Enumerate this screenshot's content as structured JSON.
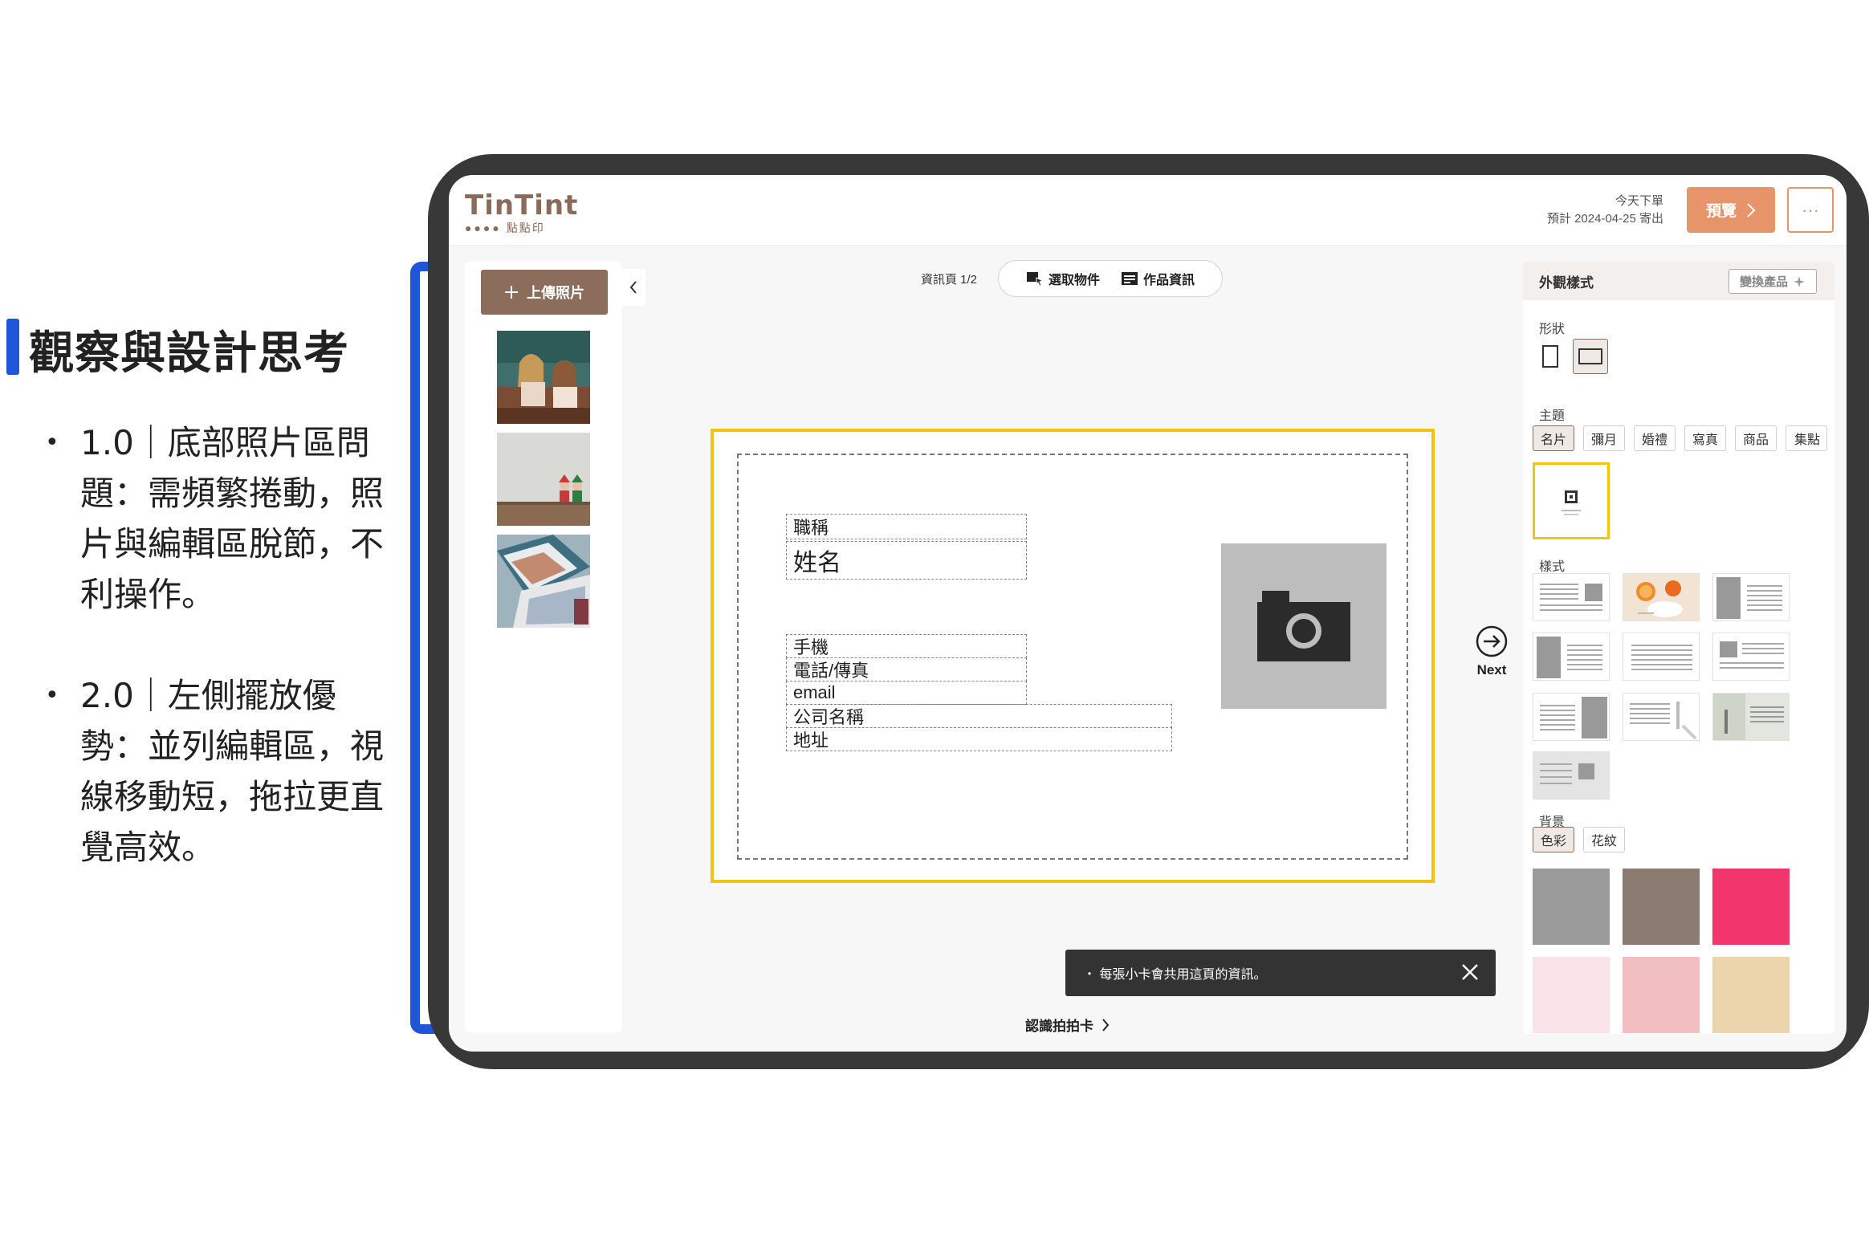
{
  "annotation": {
    "title": "觀察與設計思考",
    "bullets": [
      "1.0｜底部照片區問題：需頻繁捲動，照片與編輯區脫節，不利操作。",
      "2.0｜左側擺放優勢：並列編輯區，視線移動短，拖拉更直覺高效。"
    ]
  },
  "app": {
    "logo": "TinTint",
    "logo_sub": "點點印",
    "ship_line1": "今天下單",
    "ship_line2": "預計 2024-04-25 寄出",
    "preview_label": "預覽",
    "more_label": "···"
  },
  "left_panel": {
    "upload_label": "上傳照片",
    "collapse_icon": "chevron-left"
  },
  "toolbar": {
    "page_indicator": "資訊頁 1/2",
    "select_label": "選取物件",
    "info_label": "作品資訊"
  },
  "card": {
    "title_field": "職稱",
    "name_field": "姓名",
    "mobile_field": "手機",
    "phone_field": "電話/傳真",
    "email_field": "email",
    "company_field": "公司名稱",
    "address_field": "地址"
  },
  "next_label": "Next",
  "toast": {
    "text": "・ 每張小卡會共用這頁的資訊。"
  },
  "know_link": "認識拍拍卡",
  "right_panel": {
    "header": "外觀樣式",
    "swap_label": "變換產品",
    "shape_label": "形狀",
    "theme_label": "主題",
    "themes": [
      "名片",
      "彌月",
      "婚禮",
      "寫真",
      "商品",
      "集點"
    ],
    "style_label": "樣式",
    "bg_label": "背景",
    "bg_tabs": [
      "色彩",
      "花紋"
    ],
    "bg_colors": [
      "#9b9b9b",
      "#8c7b70",
      "#f2356a",
      "#f8e3e9",
      "#f1bfbf",
      "#ecd4ad"
    ],
    "accent": "#e7946b",
    "selected_border": "#f2c40d"
  }
}
